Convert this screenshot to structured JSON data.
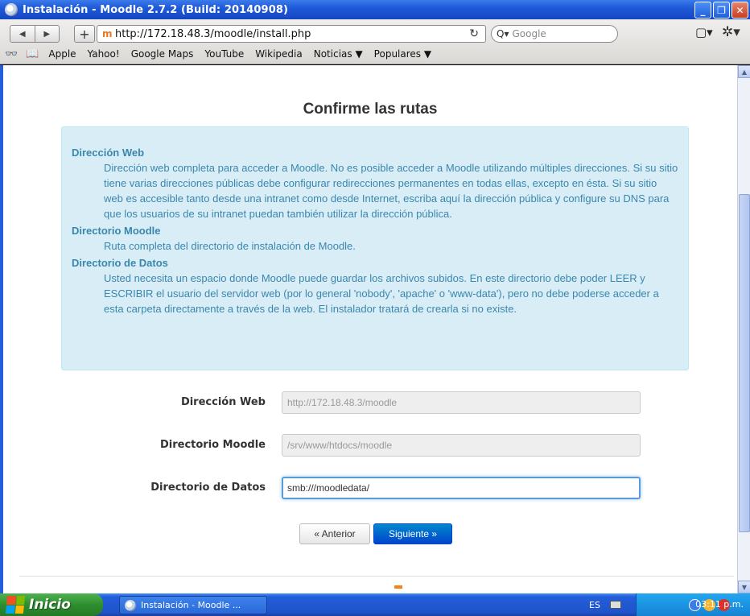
{
  "window": {
    "title": "Instalación - Moodle 2.7.2 (Build: 20140908)",
    "min": "_",
    "max": "❐",
    "close": "✕"
  },
  "toolbar": {
    "back": "◀",
    "forward": "▶",
    "add": "+",
    "favicon": "m",
    "url": "http://172.18.48.3/moodle/install.php",
    "reload": "↻",
    "search_placeholder": "Google",
    "search_icon_glyph": "Q▾",
    "page_menu": "▢▾",
    "settings_menu": "✲▾"
  },
  "bookmarks": {
    "reader_icon": "👓",
    "book_icon": "📖",
    "items": [
      "Apple",
      "Yahoo!",
      "Google Maps",
      "YouTube",
      "Wikipedia",
      "Noticias ▼",
      "Populares ▼"
    ]
  },
  "page": {
    "title": "Confirme las rutas",
    "info": [
      {
        "term": "Dirección Web",
        "desc": "Dirección web completa para acceder a Moodle. No es posible acceder a Moodle utilizando múltiples direcciones. Si su sitio tiene varias direcciones públicas debe configurar redirecciones permanentes en todas ellas, excepto en ésta. Si su sitio web es accesible tanto desde una intranet como desde Internet, escriba aquí la dirección pública y configure su DNS para que los usuarios de su intranet puedan también utilizar la dirección pública."
      },
      {
        "term": "Directorio Moodle",
        "desc": "Ruta completa del directorio de instalación de Moodle."
      },
      {
        "term": "Directorio de Datos",
        "desc": "Usted necesita un espacio donde Moodle puede guardar los archivos subidos. En este directorio debe poder LEER y ESCRIBIR el usuario del servidor web (por lo general 'nobody', 'apache' o 'www-data'), pero no debe poderse acceder a esta carpeta directamente a través de la web. El instalador tratará de crearla si no existe."
      }
    ],
    "form": {
      "wwwroot_label": "Dirección Web",
      "wwwroot_value": "http://172.18.48.3/moodle",
      "dirroot_label": "Directorio Moodle",
      "dirroot_value": "/srv/www/htdocs/moodle",
      "dataroot_label": "Directorio de Datos",
      "dataroot_value": "smb:///moodledata/"
    },
    "prev_label": "« Anterior",
    "next_label": "Siguiente »"
  },
  "taskbar": {
    "start_label": "Inicio",
    "task_label": "Instalación - Moodle ...",
    "lang": "ES",
    "clock": "03:11 p.m."
  },
  "colors": {
    "info_bg": "#d9edf7",
    "info_text": "#3a87ad",
    "primary_button": "#0070cc",
    "xp_blue": "#245edb"
  }
}
